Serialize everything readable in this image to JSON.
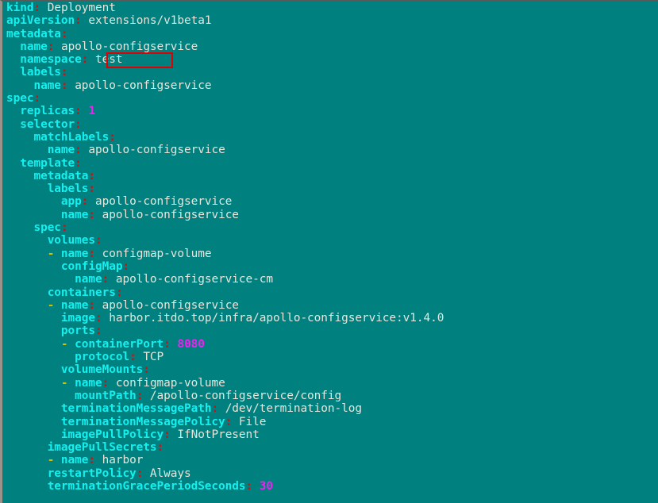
{
  "terminal": {
    "background_color": "#00807f",
    "key_color": "#14f0ef",
    "colon_color": "#d01010",
    "value_color": "#e6e6dc",
    "number_color": "#f020f0",
    "dash_color": "#cfc000",
    "highlight_color": "#e00000"
  },
  "annotation": {
    "highlight_target": "test",
    "highlight_label": "namespace-value-highlight"
  },
  "document": {
    "format": "yaml",
    "lines": [
      {
        "indent": 0,
        "dash": false,
        "key": "kind",
        "colon": ":",
        "value": "Deployment",
        "type": "string"
      },
      {
        "indent": 0,
        "dash": false,
        "key": "apiVersion",
        "colon": ":",
        "value": "extensions/v1beta1",
        "type": "string"
      },
      {
        "indent": 0,
        "dash": false,
        "key": "metadata",
        "colon": ":",
        "value": "",
        "type": "map"
      },
      {
        "indent": 2,
        "dash": false,
        "key": "name",
        "colon": ":",
        "value": "apollo-configservice",
        "type": "string"
      },
      {
        "indent": 2,
        "dash": false,
        "key": "namespace",
        "colon": ":",
        "value": "test",
        "type": "string"
      },
      {
        "indent": 2,
        "dash": false,
        "key": "labels",
        "colon": ":",
        "value": "",
        "type": "map"
      },
      {
        "indent": 4,
        "dash": false,
        "key": "name",
        "colon": ":",
        "value": "apollo-configservice",
        "type": "string"
      },
      {
        "indent": 0,
        "dash": false,
        "key": "spec",
        "colon": ":",
        "value": "",
        "type": "map"
      },
      {
        "indent": 2,
        "dash": false,
        "key": "replicas",
        "colon": ":",
        "value": "1",
        "type": "number"
      },
      {
        "indent": 2,
        "dash": false,
        "key": "selector",
        "colon": ":",
        "value": "",
        "type": "map"
      },
      {
        "indent": 4,
        "dash": false,
        "key": "matchLabels",
        "colon": ":",
        "value": "",
        "type": "map"
      },
      {
        "indent": 6,
        "dash": false,
        "key": "name",
        "colon": ":",
        "value": "apollo-configservice",
        "type": "string"
      },
      {
        "indent": 2,
        "dash": false,
        "key": "template",
        "colon": ":",
        "value": "",
        "type": "map"
      },
      {
        "indent": 4,
        "dash": false,
        "key": "metadata",
        "colon": ":",
        "value": "",
        "type": "map"
      },
      {
        "indent": 6,
        "dash": false,
        "key": "labels",
        "colon": ":",
        "value": "",
        "type": "map"
      },
      {
        "indent": 8,
        "dash": false,
        "key": "app",
        "colon": ":",
        "value": "apollo-configservice",
        "type": "string"
      },
      {
        "indent": 8,
        "dash": false,
        "key": "name",
        "colon": ":",
        "value": "apollo-configservice",
        "type": "string"
      },
      {
        "indent": 4,
        "dash": false,
        "key": "spec",
        "colon": ":",
        "value": "",
        "type": "map"
      },
      {
        "indent": 6,
        "dash": false,
        "key": "volumes",
        "colon": ":",
        "value": "",
        "type": "seq"
      },
      {
        "indent": 6,
        "dash": true,
        "key": "name",
        "colon": ":",
        "value": "configmap-volume",
        "type": "string"
      },
      {
        "indent": 8,
        "dash": false,
        "key": "configMap",
        "colon": ":",
        "value": "",
        "type": "map"
      },
      {
        "indent": 10,
        "dash": false,
        "key": "name",
        "colon": ":",
        "value": "apollo-configservice-cm",
        "type": "string"
      },
      {
        "indent": 6,
        "dash": false,
        "key": "containers",
        "colon": ":",
        "value": "",
        "type": "seq"
      },
      {
        "indent": 6,
        "dash": true,
        "key": "name",
        "colon": ":",
        "value": "apollo-configservice",
        "type": "string"
      },
      {
        "indent": 8,
        "dash": false,
        "key": "image",
        "colon": ":",
        "value": "harbor.itdo.top/infra/apollo-configservice:v1.4.0",
        "type": "string"
      },
      {
        "indent": 8,
        "dash": false,
        "key": "ports",
        "colon": ":",
        "value": "",
        "type": "seq"
      },
      {
        "indent": 8,
        "dash": true,
        "key": "containerPort",
        "colon": ":",
        "value": "8080",
        "type": "number"
      },
      {
        "indent": 10,
        "dash": false,
        "key": "protocol",
        "colon": ":",
        "value": "TCP",
        "type": "string"
      },
      {
        "indent": 8,
        "dash": false,
        "key": "volumeMounts",
        "colon": ":",
        "value": "",
        "type": "seq"
      },
      {
        "indent": 8,
        "dash": true,
        "key": "name",
        "colon": ":",
        "value": "configmap-volume",
        "type": "string"
      },
      {
        "indent": 10,
        "dash": false,
        "key": "mountPath",
        "colon": ":",
        "value": "/apollo-configservice/config",
        "type": "string"
      },
      {
        "indent": 8,
        "dash": false,
        "key": "terminationMessagePath",
        "colon": ":",
        "value": "/dev/termination-log",
        "type": "string"
      },
      {
        "indent": 8,
        "dash": false,
        "key": "terminationMessagePolicy",
        "colon": ":",
        "value": "File",
        "type": "string"
      },
      {
        "indent": 8,
        "dash": false,
        "key": "imagePullPolicy",
        "colon": ":",
        "value": "IfNotPresent",
        "type": "string"
      },
      {
        "indent": 6,
        "dash": false,
        "key": "imagePullSecrets",
        "colon": ":",
        "value": "",
        "type": "seq"
      },
      {
        "indent": 6,
        "dash": true,
        "key": "name",
        "colon": ":",
        "value": "harbor",
        "type": "string"
      },
      {
        "indent": 6,
        "dash": false,
        "key": "restartPolicy",
        "colon": ":",
        "value": "Always",
        "type": "string"
      },
      {
        "indent": 6,
        "dash": false,
        "key": "terminationGracePeriodSeconds",
        "colon": ":",
        "value": "30",
        "type": "number"
      }
    ]
  }
}
